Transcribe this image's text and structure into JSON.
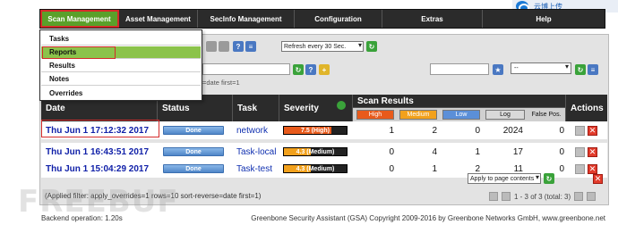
{
  "nav": {
    "items": [
      {
        "label": "Scan Management",
        "active": true
      },
      {
        "label": "Asset Management"
      },
      {
        "label": "SecInfo Management"
      },
      {
        "label": "Configuration"
      },
      {
        "label": "Extras"
      },
      {
        "label": "Help"
      }
    ]
  },
  "cloud_badge": {
    "label": "云博上传"
  },
  "dropdown": {
    "items": [
      {
        "label": "Tasks"
      },
      {
        "label": "Reports",
        "active": true
      },
      {
        "label": "Results"
      },
      {
        "label": "Notes"
      },
      {
        "label": "Overrides"
      }
    ]
  },
  "toolbar": {
    "refresh_label": "Refresh every 30 Sec.",
    "filter_hint": "=date first=1",
    "filter_select_value": "--"
  },
  "table": {
    "headers": {
      "date": "Date",
      "status": "Status",
      "task": "Task",
      "severity": "Severity",
      "scan_results": "Scan Results",
      "actions": "Actions"
    },
    "subheaders": {
      "high": "High",
      "medium": "Medium",
      "low": "Low",
      "log": "Log",
      "false_pos": "False Pos."
    },
    "rows": [
      {
        "date": "Thu Jun 1 17:12:32 2017",
        "status": "Done",
        "task": "network",
        "severity": "7.5 (High)",
        "severity_level": "high",
        "severity_fraction": 0.75,
        "high": "1",
        "medium": "2",
        "low": "0",
        "log": "2024",
        "false_pos": "0"
      },
      {
        "date": "Thu Jun 1 16:43:51 2017",
        "status": "Done",
        "task": "Task-local",
        "severity": "4.3 (Medium)",
        "severity_level": "medium",
        "severity_fraction": 0.43,
        "high": "0",
        "medium": "4",
        "low": "1",
        "log": "17",
        "false_pos": "0"
      },
      {
        "date": "Thu Jun 1 15:04:29 2017",
        "status": "Done",
        "task": "Task-test",
        "severity": "4.3 (Medium)",
        "severity_level": "medium",
        "severity_fraction": 0.43,
        "high": "0",
        "medium": "1",
        "low": "2",
        "log": "11",
        "false_pos": "0"
      }
    ]
  },
  "apply_select": "Apply to page contents",
  "applied_filter": "(Applied filter: apply_overrides=1 rows=10 sort-reverse=date first=1)",
  "pager_text": "1 - 3 of 3 (total: 3)",
  "footer": {
    "backend": "Backend operation: 1.20s",
    "copyright": "Greenbone Security Assistant (GSA) Copyright 2009-2016 by Greenbone Networks GmbH, www.greenbone.net"
  },
  "watermark": "FREEBUF",
  "colors": {
    "high": "#e85a1b",
    "medium": "#f2a11c",
    "low": "#5b8fd8",
    "log": "#d9d9d9",
    "nav_active": "#5aa02a"
  }
}
